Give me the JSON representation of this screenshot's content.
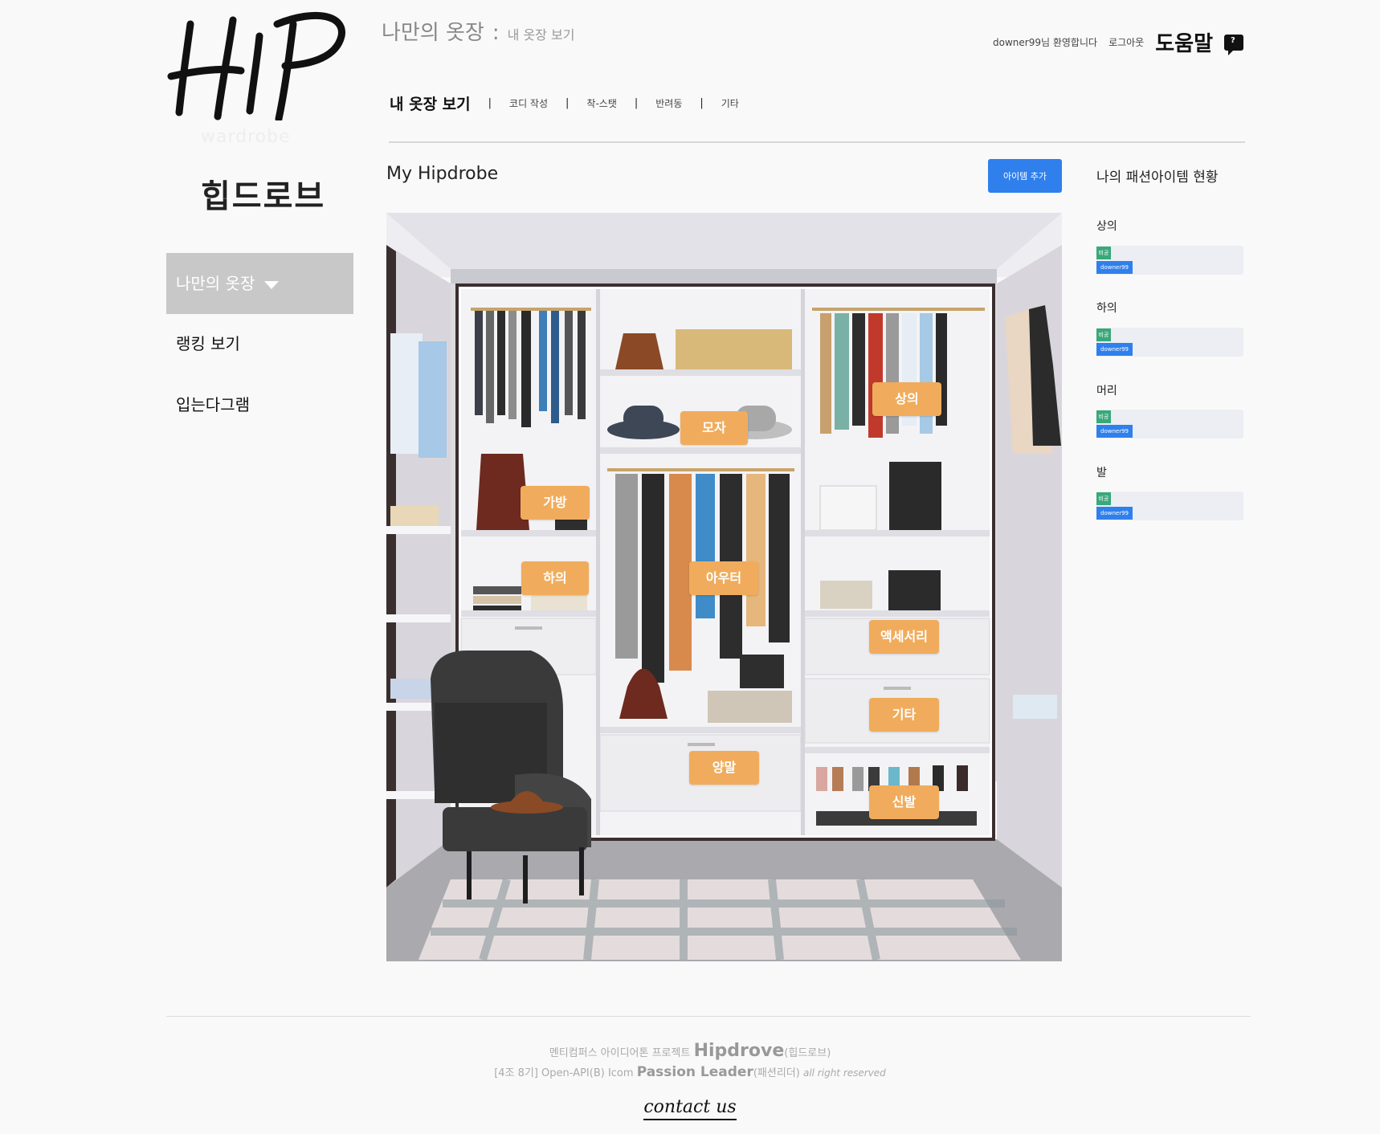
{
  "logo": {
    "text": "HIP",
    "sub": "wardrobe"
  },
  "brand": "힙드로브",
  "sidebar": {
    "items": [
      {
        "label": "나만의 옷장"
      },
      {
        "label": "랭킹 보기"
      },
      {
        "label": "입는다그램"
      }
    ]
  },
  "header": {
    "title": "나만의 옷장",
    "separator": ":",
    "subtitle": "내 옷장 보기",
    "welcome": "downer99님 환영합니다",
    "logout": "로그아웃",
    "help": "도움말"
  },
  "tabs": [
    "내 옷장 보기",
    "코디 작성",
    "착-스탯",
    "반려동",
    "기타"
  ],
  "main": {
    "title": "My Hipdrobe",
    "add_button": "아이템 추가"
  },
  "closet": {
    "categories": [
      "모자",
      "상의",
      "가방",
      "하의",
      "아우터",
      "액세서리",
      "기타",
      "양말",
      "신발"
    ]
  },
  "status_panel": {
    "title": "나의 패션아이템 현황",
    "rows": [
      {
        "label": "상의",
        "tag1": "비공",
        "tag2": "downer99"
      },
      {
        "label": "하의",
        "tag1": "비공",
        "tag2": "downer99"
      },
      {
        "label": "머리",
        "tag1": "비공",
        "tag2": "downer99"
      },
      {
        "label": "발",
        "tag1": "비공",
        "tag2": "downer99"
      }
    ]
  },
  "footer": {
    "line1_prefix": "멘티컴퍼스 아이디어톤 프로젝트",
    "line1_brand": "Hipdrove",
    "line1_suffix": "(힙드로브)",
    "line2_prefix": "[4조 8기] Open-API(B) Icom",
    "line2_brand": "Passion Leader",
    "line2_suffix": "(패션리더)",
    "line2_rights": "all right reserved",
    "contact": "contact us"
  }
}
